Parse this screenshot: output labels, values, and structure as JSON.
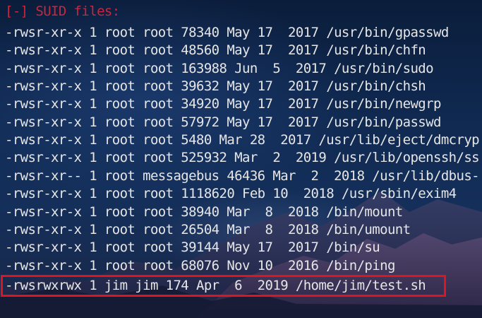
{
  "terminal": {
    "header": "[-] SUID files:",
    "lines": [
      "-rwsr-xr-x 1 root root 78340 May 17  2017 /usr/bin/gpasswd",
      "-rwsr-xr-x 1 root root 48560 May 17  2017 /usr/bin/chfn",
      "-rwsr-xr-x 1 root root 163988 Jun  5  2017 /usr/bin/sudo",
      "-rwsr-xr-x 1 root root 39632 May 17  2017 /usr/bin/chsh",
      "-rwsr-xr-x 1 root root 34920 May 17  2017 /usr/bin/newgrp",
      "-rwsr-xr-x 1 root root 57972 May 17  2017 /usr/bin/passwd",
      "-rwsr-xr-x 1 root root 5480 Mar 28  2017 /usr/lib/eject/dmcryp",
      "-rwsr-xr-x 1 root root 525932 Mar  2  2019 /usr/lib/openssh/ss",
      "-rwsr-xr-- 1 root messagebus 46436 Mar  2  2018 /usr/lib/dbus-",
      "-rwsr-xr-x 1 root root 1118620 Feb 10  2018 /usr/sbin/exim4",
      "-rwsr-xr-x 1 root root 38940 Mar  8  2018 /bin/mount",
      "-rwsr-xr-x 1 root root 26504 Mar  8  2018 /bin/umount",
      "-rwsr-xr-x 1 root root 39144 May 17  2017 /bin/su",
      "-rwsr-xr-x 1 root root 68076 Nov 10  2016 /bin/ping",
      "-rwsrwxrwx 1 jim jim 174 Apr  6  2019 /home/jim/test.sh"
    ]
  },
  "colors": {
    "header": "#c9263f",
    "text": "#e6e6e6",
    "highlight_border": "#e0141e"
  }
}
